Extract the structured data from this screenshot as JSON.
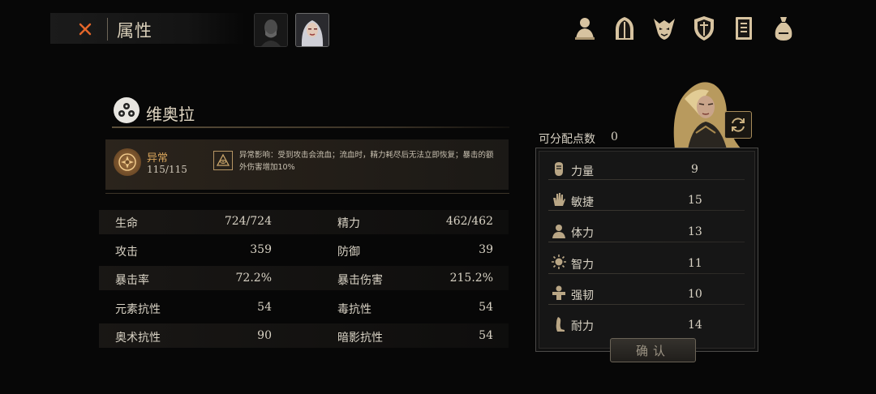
{
  "header": {
    "close_icon": "close-x-icon",
    "title": "属性",
    "portraits": [
      "old-man-portrait",
      "white-hair-woman-portrait"
    ],
    "top_icons": [
      "bust-icon",
      "helmet-icon",
      "demon-face-icon",
      "shield-icon",
      "spellbook-icon",
      "pouch-icon"
    ]
  },
  "character": {
    "name": "维奥拉",
    "emblem_icon": "tri-faces-emblem-icon"
  },
  "status_effect": {
    "name": "异常",
    "value": "115/115",
    "badge_icon": "affliction-badge-icon",
    "effect_icon": "eye-triangle-icon",
    "description": "异常影响：受到攻击会流血；流血时，精力耗尽后无法立即恢复；暴击的额外伤害增加10%"
  },
  "stats": [
    {
      "left_label": "生命",
      "left_value": "724/724",
      "right_label": "精力",
      "right_value": "462/462"
    },
    {
      "left_label": "攻击",
      "left_value": "359",
      "right_label": "防御",
      "right_value": "39"
    },
    {
      "left_label": "暴击率",
      "left_value": "72.2%",
      "right_label": "暴击伤害",
      "right_value": "215.2%"
    },
    {
      "left_label": "元素抗性",
      "left_value": "54",
      "right_label": "毒抗性",
      "right_value": "54"
    },
    {
      "left_label": "奥术抗性",
      "left_value": "90",
      "right_label": "暗影抗性",
      "right_value": "54"
    }
  ],
  "allocation": {
    "points_label": "可分配点数",
    "points_value": "0",
    "refresh_icon": "refresh-icon",
    "attributes": [
      {
        "icon": "fist-icon",
        "label": "力量",
        "value": "9"
      },
      {
        "icon": "hand-icon",
        "label": "敏捷",
        "value": "15"
      },
      {
        "icon": "torso-icon",
        "label": "体力",
        "value": "13"
      },
      {
        "icon": "sun-head-icon",
        "label": "智力",
        "value": "11"
      },
      {
        "icon": "cross-body-icon",
        "label": "强韧",
        "value": "10"
      },
      {
        "icon": "leg-icon",
        "label": "耐力",
        "value": "14"
      }
    ],
    "confirm_label": "确认"
  },
  "colors": {
    "accent": "#e3662a",
    "gold": "#d8a55c",
    "text": "#d8d2c4",
    "background": "#070707"
  }
}
